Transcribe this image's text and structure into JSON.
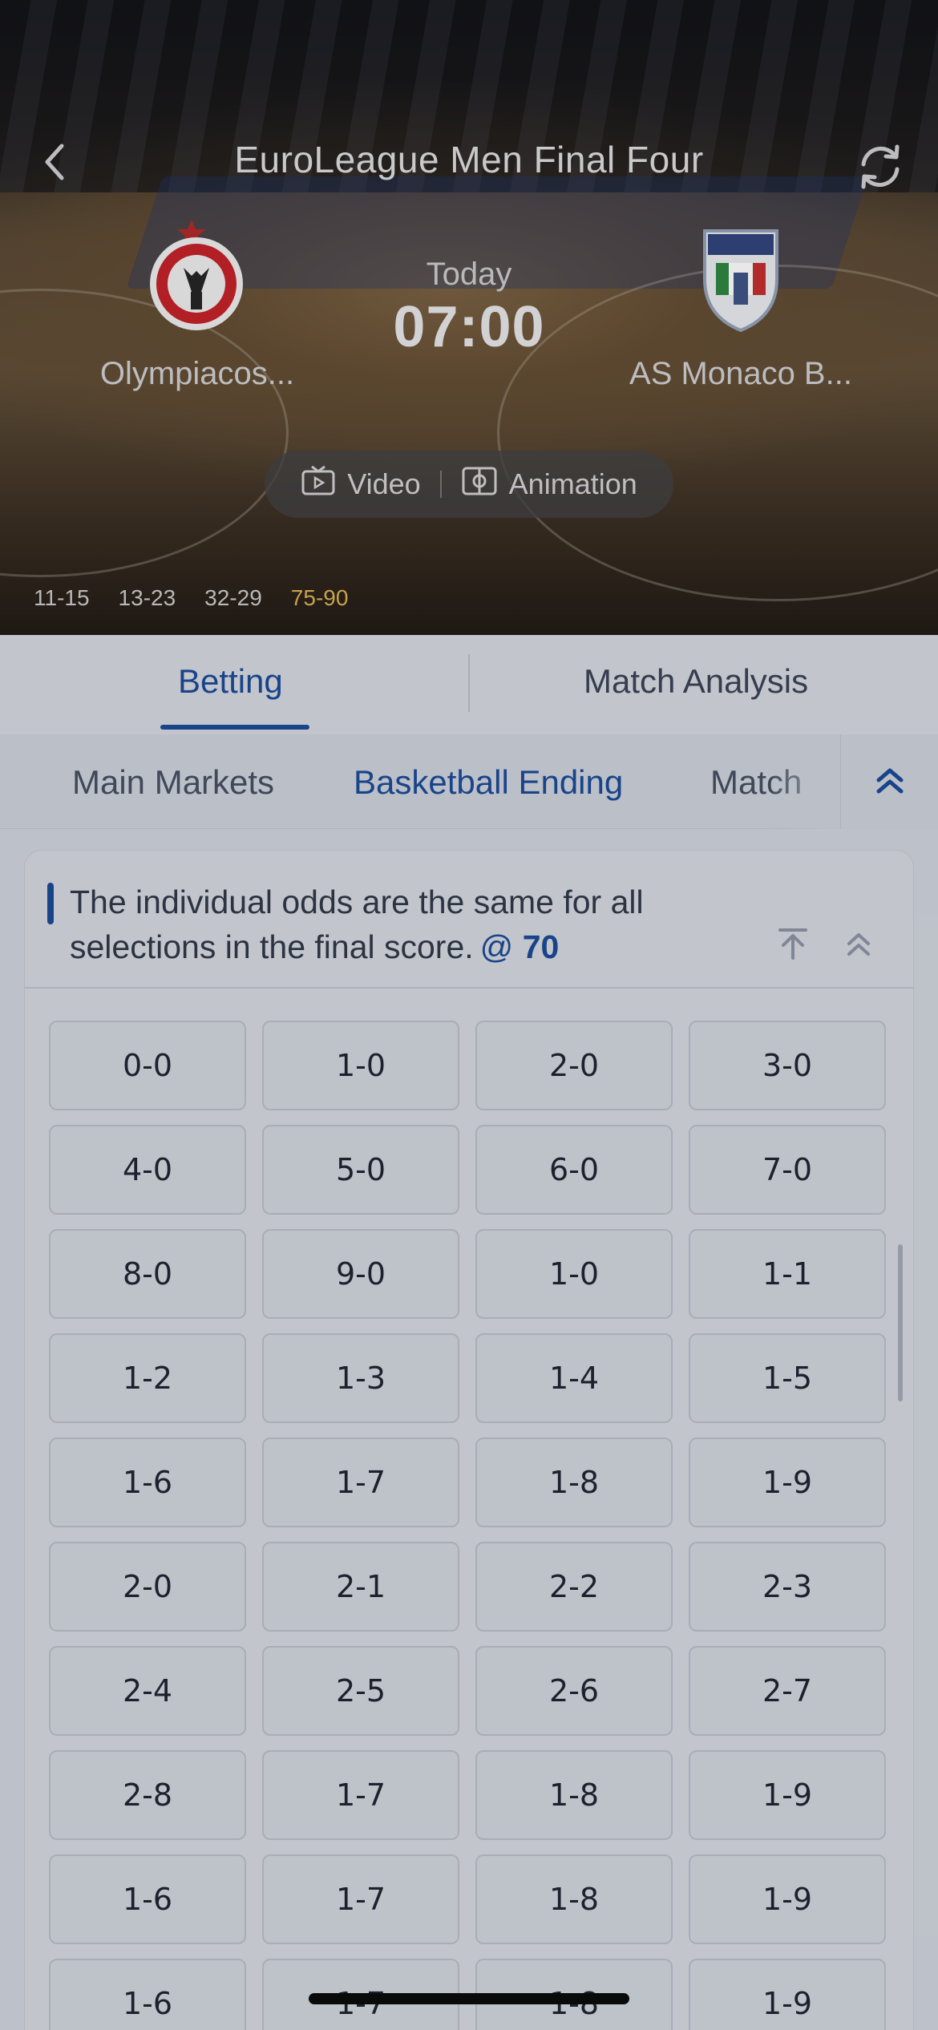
{
  "header": {
    "title": "EuroLeague Men Final Four",
    "icons": {
      "back": "chevron-left-icon",
      "refresh": "refresh-icon"
    }
  },
  "match": {
    "home_team": "Olympiacos...",
    "away_team": "AS Monaco B...",
    "day": "Today",
    "time": "07:00",
    "media": {
      "video_label": "Video",
      "animation_label": "Animation"
    },
    "quarters": [
      "11-15",
      "13-23",
      "32-29",
      "75-90"
    ]
  },
  "tabs": [
    {
      "label": "Betting",
      "active": true
    },
    {
      "label": "Match Analysis",
      "active": false
    }
  ],
  "sub_tabs": [
    {
      "label": "Main Markets",
      "active": false
    },
    {
      "label": "Basketball Ending",
      "active": true
    },
    {
      "label": "Match",
      "active": false
    }
  ],
  "market": {
    "notice": "The individual odds are the same for all selections in the final score.",
    "odds_prefix": "@",
    "odds_value": "70",
    "selections": [
      "0-0",
      "1-0",
      "2-0",
      "3-0",
      "4-0",
      "5-0",
      "6-0",
      "7-0",
      "8-0",
      "9-0",
      "1-0",
      "1-1",
      "1-2",
      "1-3",
      "1-4",
      "1-5",
      "1-6",
      "1-7",
      "1-8",
      "1-9",
      "2-0",
      "2-1",
      "2-2",
      "2-3",
      "2-4",
      "2-5",
      "2-6",
      "2-7",
      "2-8",
      "1-7",
      "1-8",
      "1-9",
      "1-6",
      "1-7",
      "1-8",
      "1-9",
      "1-6",
      "1-7",
      "1-8",
      "1-9"
    ]
  },
  "colors": {
    "accent": "#1b4fa3",
    "current_quarter": "#c8a24a",
    "background": "#e8ecf2"
  }
}
